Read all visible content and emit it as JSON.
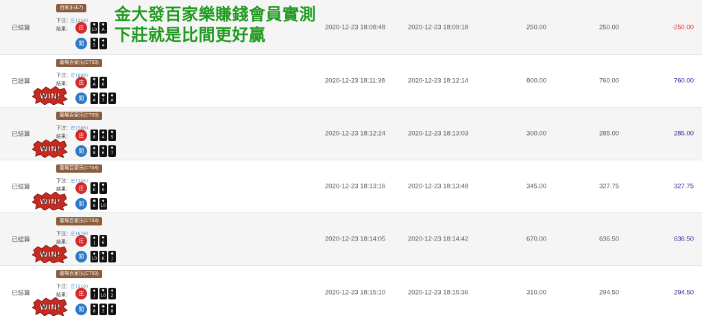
{
  "overlay": {
    "line1": "金大發百家樂賺錢會員實測",
    "line2": "下莊就是比間更好贏"
  },
  "labels": {
    "bet": "下注：",
    "result": "結果：",
    "banker": "庄",
    "player": "閒",
    "banker_prefix": "庄"
  },
  "colors": {
    "win_positive": "#2b2b9e",
    "win_negative": "#e03030",
    "banker_circle": "#d22b2b",
    "player_circle": "#2d79c7",
    "overlay_text": "#1f9a1f",
    "game_tag": "#8a5c3c"
  },
  "rows": [
    {
      "status": "已結算",
      "game": "百家乐(E7)",
      "bet_value": "(250)",
      "banker_cards": [
        {
          "s": "♥",
          "r": "10"
        },
        {
          "s": "♥",
          "r": "A"
        }
      ],
      "player_cards": [
        {
          "s": "♥",
          "r": "5"
        },
        {
          "s": "♠",
          "r": "4"
        }
      ],
      "bet_time": "2020-12-23 18:08:48",
      "settle_time": "2020-12-23 18:09:18",
      "bet_amount": "250.00",
      "valid_bet": "250.00",
      "win_loss": "-250.00",
      "badge": ""
    },
    {
      "status": "已結算",
      "game": "龍場百家乐(CT03)",
      "bet_value": "(800)",
      "banker_cards": [
        {
          "s": "♥",
          "r": "A"
        },
        {
          "s": "♠",
          "r": "6"
        }
      ],
      "player_cards": [
        {
          "s": "♥",
          "r": "A"
        },
        {
          "s": "♣",
          "r": "3"
        },
        {
          "s": "♠",
          "r": "A"
        }
      ],
      "bet_time": "2020-12-23 18:11:38",
      "settle_time": "2020-12-23 18:12:14",
      "bet_amount": "800.00",
      "valid_bet": "760.00",
      "win_loss": "760.00",
      "badge": "WIN!"
    },
    {
      "status": "已結算",
      "game": "龍場百家乐(CT03)",
      "bet_value": "(300)",
      "banker_cards": [
        {
          "s": "♥",
          "r": "8"
        },
        {
          "s": "♠",
          "r": "4"
        },
        {
          "s": "♥",
          "r": "5"
        }
      ],
      "player_cards": [
        {
          "s": "♠",
          "r": "8"
        },
        {
          "s": "♦",
          "r": "6"
        },
        {
          "s": "♥",
          "r": "7"
        }
      ],
      "bet_time": "2020-12-23 18:12:24",
      "settle_time": "2020-12-23 18:13:03",
      "bet_amount": "300.00",
      "valid_bet": "285.00",
      "win_loss": "285.00",
      "badge": "WIN!"
    },
    {
      "status": "已結算",
      "game": "龍場百家乐(CT03)",
      "bet_value": "(345)",
      "banker_cards": [
        {
          "s": "♠",
          "r": "K"
        },
        {
          "s": "♥",
          "r": "9"
        }
      ],
      "player_cards": [
        {
          "s": "♣",
          "r": "6"
        },
        {
          "s": "♦",
          "r": "10"
        }
      ],
      "bet_time": "2020-12-23 18:13:16",
      "settle_time": "2020-12-23 18:13:48",
      "bet_amount": "345.00",
      "valid_bet": "327.75",
      "win_loss": "327.75",
      "badge": "WIN!"
    },
    {
      "status": "已結算",
      "game": "龍場百家乐(CT03)",
      "bet_value": "(670)",
      "banker_cards": [
        {
          "s": "♠",
          "r": "J"
        },
        {
          "s": "♥",
          "r": "6"
        }
      ],
      "player_cards": [
        {
          "s": "♠",
          "r": "10"
        },
        {
          "s": "♥",
          "r": "K"
        },
        {
          "s": "♣",
          "r": "J"
        }
      ],
      "bet_time": "2020-12-23 18:14:05",
      "settle_time": "2020-12-23 18:14:42",
      "bet_amount": "670.00",
      "valid_bet": "636.50",
      "win_loss": "636.50",
      "badge": "WIN!"
    },
    {
      "status": "已結算",
      "game": "龍場百家乐(CT03)",
      "bet_value": "(310)",
      "banker_cards": [
        {
          "s": "♠",
          "r": "J"
        },
        {
          "s": "♥",
          "r": "10"
        },
        {
          "s": "♦",
          "r": "2"
        }
      ],
      "player_cards": [
        {
          "s": "♥",
          "r": "8"
        },
        {
          "s": "♣",
          "r": "3"
        },
        {
          "s": "♠",
          "r": "8"
        }
      ],
      "bet_time": "2020-12-23 18:15:10",
      "settle_time": "2020-12-23 18:15:36",
      "bet_amount": "310.00",
      "valid_bet": "294.50",
      "win_loss": "294.50",
      "badge": "WIN!"
    }
  ]
}
